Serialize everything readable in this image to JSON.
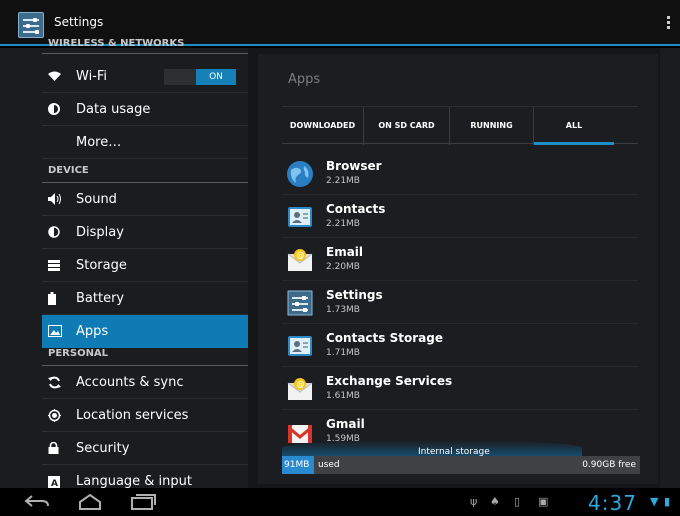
{
  "actionbar": {
    "title": "Settings"
  },
  "sidebar": {
    "categories": {
      "wireless": "WIRELESS & NETWORKS",
      "device": "DEVICE",
      "personal": "PERSONAL"
    },
    "items": [
      {
        "label": "Wi-Fi",
        "icon": "wifi-icon",
        "toggle": "ON"
      },
      {
        "label": "Data usage",
        "icon": "data-usage-icon"
      },
      {
        "label": "More…",
        "icon": ""
      },
      {
        "label": "Sound",
        "icon": "speaker-icon"
      },
      {
        "label": "Display",
        "icon": "brightness-icon"
      },
      {
        "label": "Storage",
        "icon": "storage-icon"
      },
      {
        "label": "Battery",
        "icon": "battery-icon"
      },
      {
        "label": "Apps",
        "icon": "apps-icon",
        "selected": true
      },
      {
        "label": "Accounts & sync",
        "icon": "sync-icon"
      },
      {
        "label": "Location services",
        "icon": "location-icon"
      },
      {
        "label": "Security",
        "icon": "lock-icon"
      },
      {
        "label": "Language & input",
        "icon": "keyboard-icon"
      }
    ]
  },
  "content": {
    "heading": "Apps",
    "tabs": [
      "DOWNLOADED",
      "ON SD CARD",
      "RUNNING",
      "ALL"
    ],
    "active_tab": "ALL",
    "apps": [
      {
        "name": "Browser",
        "size": "2.21MB",
        "icon": "browser-icon"
      },
      {
        "name": "Contacts",
        "size": "2.21MB",
        "icon": "contacts-icon"
      },
      {
        "name": "Email",
        "size": "2.20MB",
        "icon": "email-icon"
      },
      {
        "name": "Settings",
        "size": "1.73MB",
        "icon": "settings-icon"
      },
      {
        "name": "Contacts Storage",
        "size": "1.71MB",
        "icon": "contacts-storage-icon"
      },
      {
        "name": "Exchange Services",
        "size": "1.61MB",
        "icon": "exchange-icon"
      },
      {
        "name": "Gmail",
        "size": "1.59MB",
        "icon": "gmail-icon"
      }
    ],
    "storage": {
      "title": "Internal storage",
      "used_value": "91MB",
      "used_suffix": "used",
      "free": "0.90GB free"
    }
  },
  "statusbar": {
    "time": "4:37"
  },
  "colors": {
    "accent": "#1e8fc6",
    "selected": "#0f7bb4",
    "clock": "#2fa8e0"
  }
}
